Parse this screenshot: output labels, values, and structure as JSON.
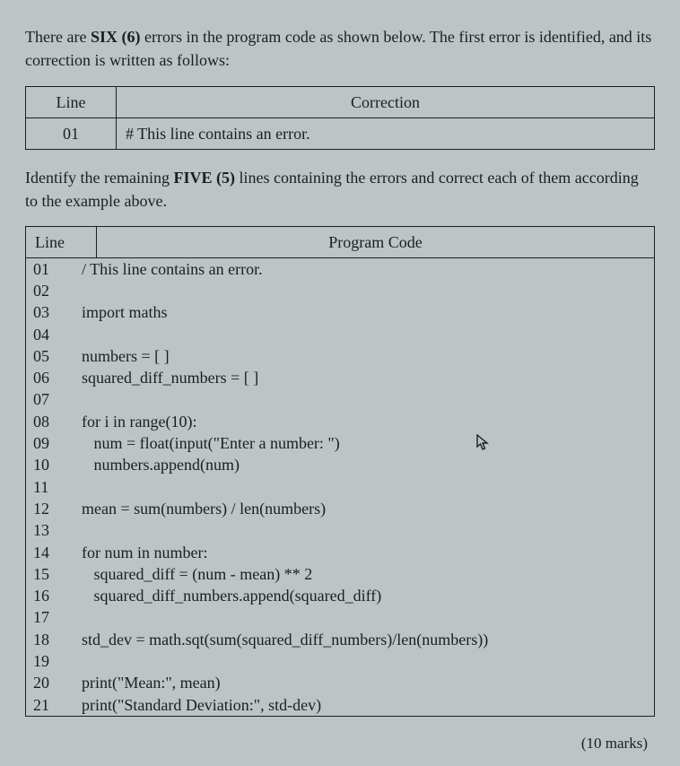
{
  "intro": {
    "text_before_six": "There are ",
    "six": "SIX (6)",
    "text_after_six": " errors in the program code as shown below. The first error is identified, and its correction is written as follows:"
  },
  "correction_table": {
    "header_line": "Line",
    "header_correction": "Correction",
    "row_line": "01",
    "row_correction": "# This line contains an error."
  },
  "instruction": {
    "text_before_five": "Identify the remaining ",
    "five": "FIVE (5)",
    "text_after_five": " lines containing the errors and correct each of them according to the example above."
  },
  "code_table": {
    "header_line": "Line",
    "header_code": "Program Code",
    "rows": [
      {
        "ln": "01",
        "code": "/ This line contains an error."
      },
      {
        "ln": "02",
        "code": ""
      },
      {
        "ln": "03",
        "code": "import maths"
      },
      {
        "ln": "04",
        "code": ""
      },
      {
        "ln": "05",
        "code": "numbers = [ ]"
      },
      {
        "ln": "06",
        "code": "squared_diff_numbers = [ ]"
      },
      {
        "ln": "07",
        "code": ""
      },
      {
        "ln": "08",
        "code": "for i in range(10):"
      },
      {
        "ln": "09",
        "code": "   num = float(input(\"Enter a number: \")"
      },
      {
        "ln": "10",
        "code": "   numbers.append(num)"
      },
      {
        "ln": "11",
        "code": ""
      },
      {
        "ln": "12",
        "code": "mean = sum(numbers) / len(numbers)"
      },
      {
        "ln": "13",
        "code": ""
      },
      {
        "ln": "14",
        "code": "for num in number:"
      },
      {
        "ln": "15",
        "code": "   squared_diff = (num - mean) ** 2"
      },
      {
        "ln": "16",
        "code": "   squared_diff_numbers.append(squared_diff)"
      },
      {
        "ln": "17",
        "code": ""
      },
      {
        "ln": "18",
        "code": "std_dev = math.sqt(sum(squared_diff_numbers)/len(numbers))"
      },
      {
        "ln": "19",
        "code": ""
      },
      {
        "ln": "20",
        "code": "print(\"Mean:\", mean)"
      },
      {
        "ln": "21",
        "code": "print(\"Standard Deviation:\", std-dev)"
      }
    ]
  },
  "cursor_glyph": "⇱",
  "marks": "(10 marks)"
}
